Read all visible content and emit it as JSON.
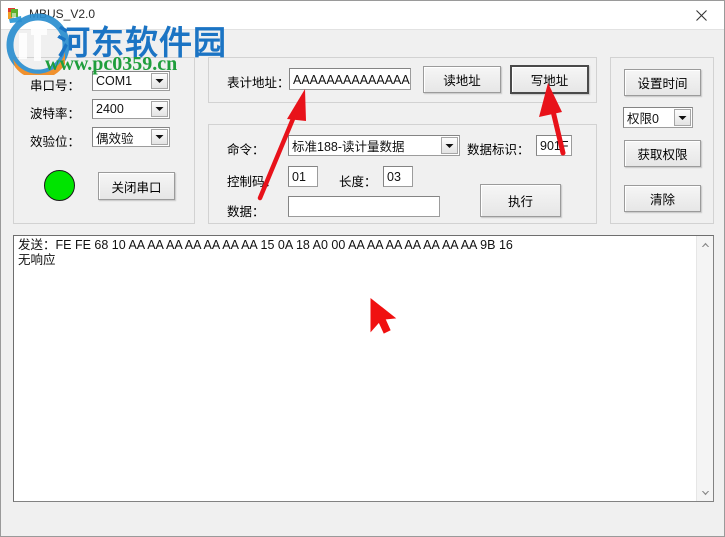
{
  "window": {
    "title": "MBUS_V2.0",
    "close_label": "×",
    "app_icon": "app-icon"
  },
  "watermark": {
    "site_name": "河东软件园",
    "url": "www.pc0359.cn",
    "name_color": "#1b74c4",
    "url_color": "#1f9e3c"
  },
  "serial_panel": {
    "port_label": "串口号：",
    "port_value": "COM1",
    "baud_label": "波特率：",
    "baud_value": "2400",
    "parity_label": "效验位：",
    "parity_value": "偶效验",
    "status_indicator": "connected",
    "status_color": "#00e400",
    "close_port_label": "关闭串口"
  },
  "address_panel": {
    "meter_address_label": "表计地址：",
    "meter_address_value": "AAAAAAAAAAAAAA",
    "read_address_label": "读地址",
    "write_address_label": "写地址"
  },
  "command_panel": {
    "command_label": "命令：",
    "command_value": "标准188-读计量数据",
    "data_id_label": "数据标识：",
    "data_id_value": "901F",
    "control_code_label": "控制码：",
    "control_code_value": "01",
    "length_label": "长度：",
    "length_value": "03",
    "data_label": "数据：",
    "data_value": "",
    "execute_label": "执行"
  },
  "right_panel": {
    "set_time_label": "设置时间",
    "permission_value": "权限0",
    "get_permission_label": "获取权限",
    "clear_label": "清除"
  },
  "log": {
    "lines": [
      "发送：FE FE 68 10 AA AA AA AA AA AA AA 15 0A 18 A0 00 AA AA AA AA AA AA AA 9B 16",
      "无响应"
    ],
    "text": "发送：FE FE 68 10 AA AA AA AA AA AA AA 15 0A 18 A0 00 AA AA AA AA AA AA AA 9B 16\n无响应"
  },
  "annotations": {
    "arrow_color": "#e8121a",
    "cursor_color": "#f01010"
  }
}
